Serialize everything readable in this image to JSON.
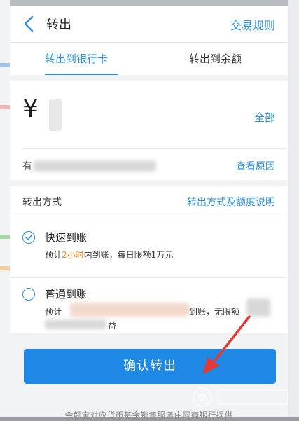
{
  "header": {
    "title": "转出",
    "rules_link": "交易规则"
  },
  "tabs": [
    {
      "label": "转出到银行卡",
      "active": true
    },
    {
      "label": "转出到余额",
      "active": false
    }
  ],
  "amount": {
    "currency_symbol": "¥",
    "all_label": "全部",
    "available_prefix": "有",
    "view_reason_label": "查看原因"
  },
  "method": {
    "label": "转出方式",
    "note_link": "转出方式及额度说明",
    "options": [
      {
        "title": "快速到账",
        "desc_prefix": "预计",
        "desc_highlight": "2小时",
        "desc_suffix": "内到账，每日限额1万元",
        "selected": true
      },
      {
        "title": "普通到账",
        "desc_line1_start": "预计",
        "desc_line1_end": "到账，无限额",
        "desc_line2_end": "益",
        "selected": false
      }
    ]
  },
  "confirm_label": "确认转出",
  "footer_note": "余额宝对应货币基金销售服务由网商银行提供",
  "colors": {
    "accent": "#2f8fd8",
    "button": "#1e88e5",
    "highlight": "#f5862a",
    "annotation_arrow": "#e53935"
  }
}
